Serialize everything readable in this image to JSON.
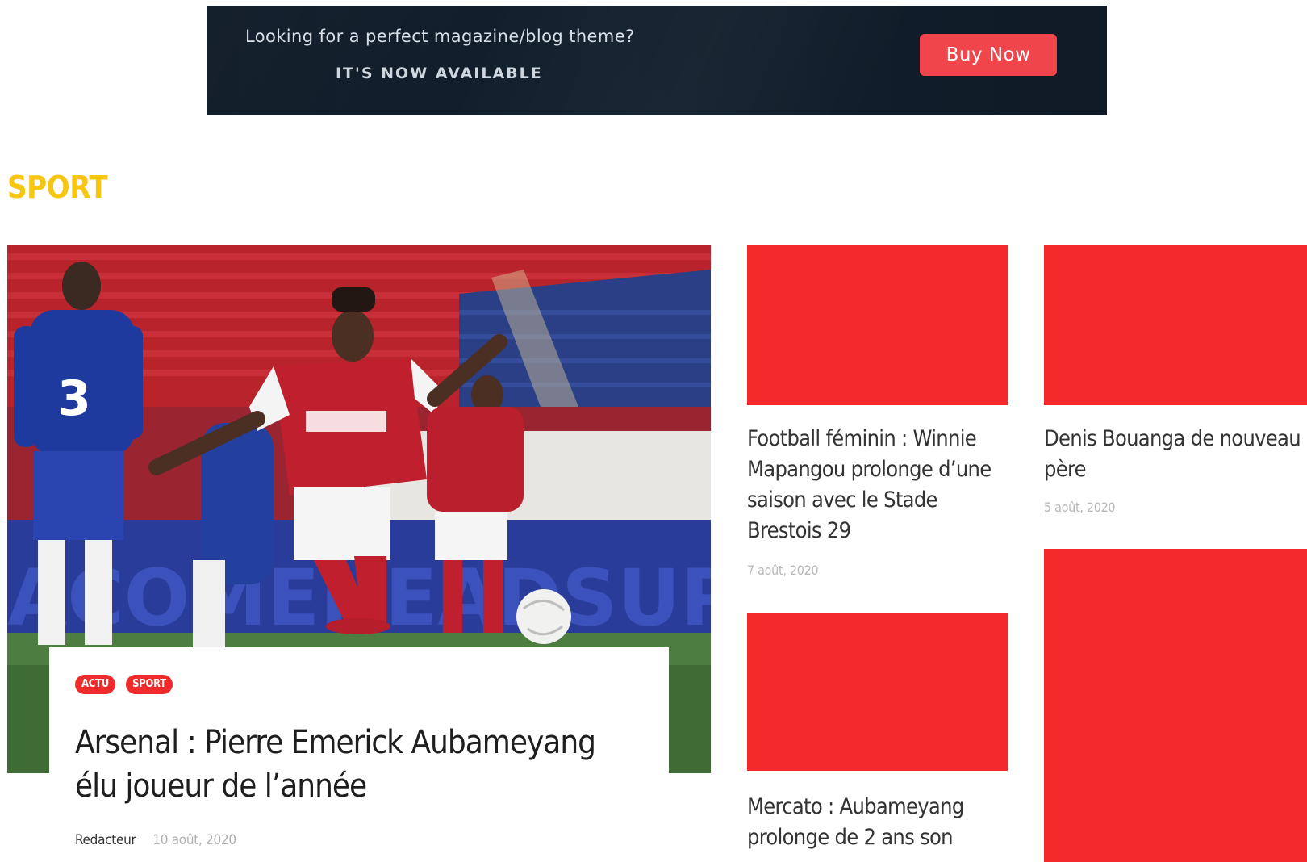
{
  "banner": {
    "line1": "Looking for a perfect magazine/blog theme?",
    "line2": "IT'S NOW AVAILABLE",
    "button_label": "Buy Now"
  },
  "section": {
    "title": "SPORT"
  },
  "featured": {
    "image_alt": "Football player in red kit taking a penalty kick",
    "categories": [
      "ACTU",
      "SPORT"
    ],
    "title": "Arsenal : Pierre Emerick Aubameyang élu joueur de l’année",
    "author": "Redacteur",
    "date": "10 août, 2020"
  },
  "side_articles": [
    {
      "title": "Football féminin : Winnie Mapangou prolonge d’une saison avec le Stade Brestois 29",
      "date": "7 août, 2020",
      "thumb_color": "#f3292b"
    },
    {
      "title": "Denis Bouanga de nouveau père",
      "date": "5 août, 2020",
      "thumb_color": "#f3292b"
    },
    {
      "title": "Mercato : Aubameyang prolonge de 2 ans son",
      "date": "",
      "thumb_color": "#f3292b"
    },
    {
      "title": "",
      "date": "",
      "thumb_color": "#f3292b"
    }
  ],
  "colors": {
    "accent_yellow": "#f7c613",
    "badge_red": "#ee2c2c",
    "button_red": "#f0454a",
    "banner_bg": "#13202e"
  }
}
